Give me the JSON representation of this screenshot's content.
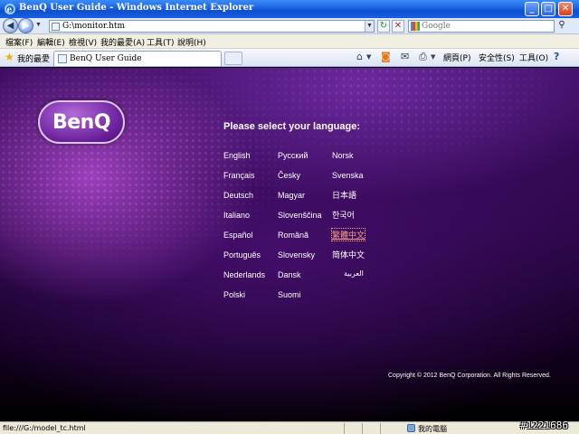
{
  "window": {
    "title": "BenQ User Guide - Windows Internet Explorer",
    "minimize_glyph": "_",
    "maximize_glyph": "□",
    "close_glyph": "✕"
  },
  "address_bar": {
    "back_glyph": "◀",
    "forward_glyph": "▶",
    "url": "G:\\monitor.htm",
    "refresh_glyph": "↻",
    "stop_glyph": "✕",
    "search_placeholder": "Google",
    "search_glyph": "⚲"
  },
  "menu": {
    "items": [
      "檔案(F)",
      "編輯(E)",
      "檢視(V)",
      "我的最愛(A)",
      "工具(T)",
      "說明(H)"
    ]
  },
  "favorites_bar": {
    "favorites_label": "我的最愛",
    "tab_title": "BenQ User Guide",
    "tools": {
      "page": "網頁(P)",
      "safety": "安全性(S)",
      "tools": "工具(O)",
      "help_glyph": "?"
    }
  },
  "content": {
    "logo_text": "BenQ",
    "heading": "Please select your language:",
    "languages": {
      "col1": [
        "English",
        "Français",
        "Deutsch",
        "Italiano",
        "Español",
        "Português",
        "Nederlands",
        "Polski"
      ],
      "col2": [
        "Русский",
        "Česky",
        "Magyar",
        "Slovenščina",
        "Română",
        "Slovensky",
        "Dansk",
        "Suomi"
      ],
      "col3": [
        "Norsk",
        "Svenska",
        "日本語",
        "한국어",
        "繁體中文",
        "简体中文",
        "العربية"
      ]
    },
    "active_language": "繁體中文",
    "copyright": "Copyright © 2012 BenQ Corporation. All Rights Reserved."
  },
  "status_bar": {
    "text": "file:///G:/model_tc.html",
    "zone": "我的電腦"
  },
  "watermark": "#1221686"
}
